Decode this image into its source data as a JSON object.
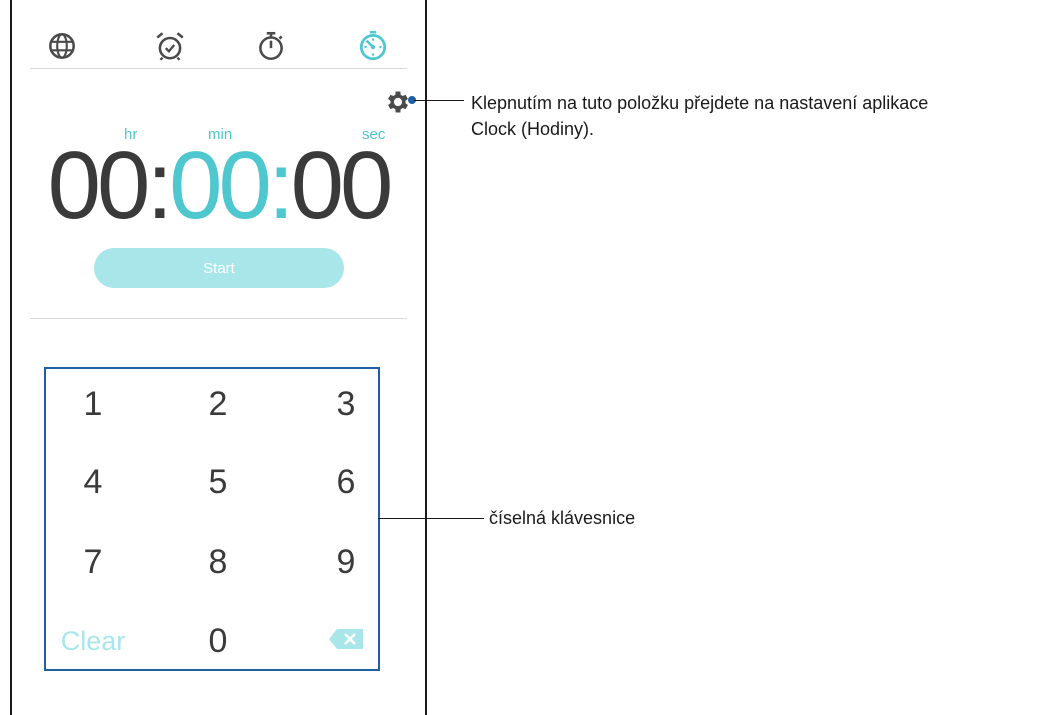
{
  "tabs": [
    {
      "name": "world-clock",
      "icon": "globe-icon"
    },
    {
      "name": "alarm",
      "icon": "alarm-clock-icon"
    },
    {
      "name": "stopwatch",
      "icon": "stopwatch-icon"
    },
    {
      "name": "timer",
      "icon": "timer-icon",
      "active": true
    }
  ],
  "timer": {
    "units": {
      "hr": "hr",
      "min": "min",
      "sec": "sec"
    },
    "hours": "00",
    "minutes": "00",
    "seconds": "00",
    "separator": ":",
    "start_label": "Start"
  },
  "keypad": {
    "keys": [
      "1",
      "2",
      "3",
      "4",
      "5",
      "6",
      "7",
      "8",
      "9"
    ],
    "clear_label": "Clear",
    "zero": "0",
    "backspace_icon": "backspace-icon"
  },
  "callouts": {
    "settings": "Klepnutím na tuto položku přejdete na nastavení aplikace\nClock (Hodiny).",
    "keypad": "číselná klávesnice"
  },
  "colors": {
    "accent": "#4ec7cf",
    "button_disabled": "#a8e6ea",
    "callout_frame": "#1f5fa6",
    "text_dark": "#3a3a3a"
  }
}
